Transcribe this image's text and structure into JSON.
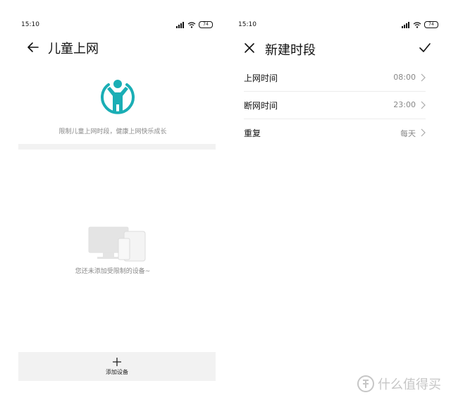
{
  "left_screen": {
    "status": {
      "time": "15:10",
      "battery": "74"
    },
    "title": "儿童上网",
    "hero_text": "限制儿童上网时段，健康上网快乐成长",
    "empty_text": "您还未添加受限制的设备~",
    "add_device_label": "添加设备",
    "accent": "#1aaeb5"
  },
  "right_screen": {
    "status": {
      "time": "15:10",
      "battery": "74"
    },
    "title": "新建时段",
    "rows": [
      {
        "label": "上网时间",
        "value": "08:00"
      },
      {
        "label": "断网时间",
        "value": "23:00"
      },
      {
        "label": "重复",
        "value": "每天"
      }
    ]
  },
  "watermark": {
    "text": "什么值得买"
  }
}
